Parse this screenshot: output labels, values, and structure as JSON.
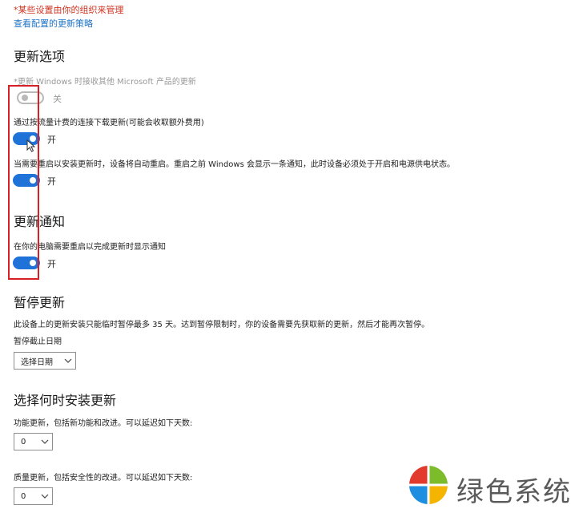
{
  "banner": {
    "managed_note": "*某些设置由你的组织来管理",
    "policy_link": "查看配置的更新策略"
  },
  "update_options": {
    "heading": "更新选项",
    "items": [
      {
        "label": "*更新 Windows 时接收其他 Microsoft 产品的更新",
        "state": "关",
        "on": false,
        "disabled": true
      },
      {
        "label": "通过按流量计费的连接下载更新(可能会收取额外费用)",
        "state": "开",
        "on": true,
        "disabled": false
      },
      {
        "label": "当需要重启以安装更新时，设备将自动重启。重启之前 Windows 会显示一条通知，此时设备必须处于开启和电源供电状态。",
        "state": "开",
        "on": true,
        "disabled": false
      }
    ]
  },
  "update_notifications": {
    "heading": "更新通知",
    "label": "在你的电脑需要重启以完成更新时显示通知",
    "state": "开",
    "on": true
  },
  "pause_updates": {
    "heading": "暂停更新",
    "description": "此设备上的更新安装只能临时暂停最多 35 天。达到暂停限制时，你的设备需要先获取新的更新，然后才能再次暂停。",
    "until_label": "暂停截止日期",
    "select_value": "选择日期"
  },
  "install_timing": {
    "heading": "选择何时安装更新",
    "feature_label": "功能更新，包括新功能和改进。可以延迟如下天数:",
    "feature_value": "0",
    "quality_label": "质量更新，包括安全性的改进。可以延迟如下天数:",
    "quality_value": "0"
  },
  "watermark": {
    "brand_text": "绿色系统"
  },
  "colors": {
    "accent": "#1f73d8",
    "highlight_box": "#d91f26",
    "managed_text": "#d0321f",
    "link": "#1f74c6"
  }
}
